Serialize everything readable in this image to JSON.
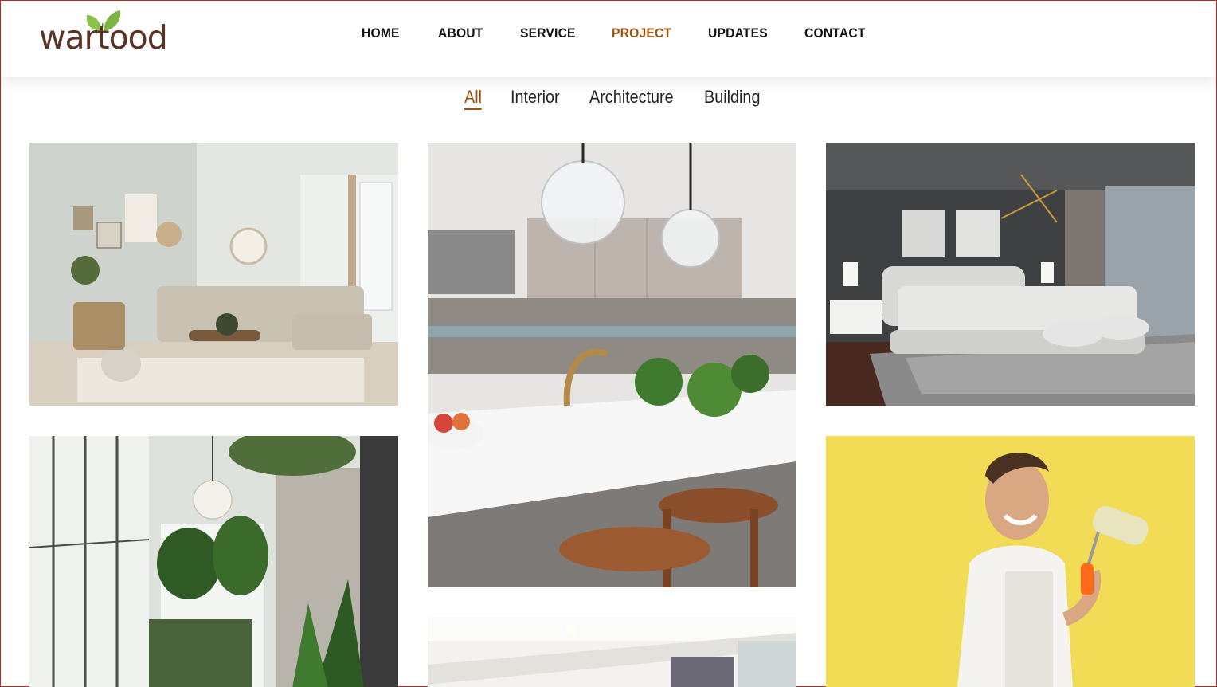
{
  "logo": {
    "text": "wartood"
  },
  "nav": {
    "items": [
      {
        "label": "HOME",
        "active": false
      },
      {
        "label": "ABOUT",
        "active": false
      },
      {
        "label": "SERVICE",
        "active": false
      },
      {
        "label": "PROJECT",
        "active": true
      },
      {
        "label": "UPDATES",
        "active": false
      },
      {
        "label": "CONTACT",
        "active": false
      }
    ]
  },
  "filters": {
    "items": [
      {
        "label": "All",
        "active": true
      },
      {
        "label": "Interior",
        "active": false
      },
      {
        "label": "Architecture",
        "active": false
      },
      {
        "label": "Building",
        "active": false
      }
    ]
  },
  "gallery": {
    "photos": [
      {
        "subject": "living-room"
      },
      {
        "subject": "kitchen"
      },
      {
        "subject": "bedroom"
      },
      {
        "subject": "sunroom"
      },
      {
        "subject": "ceiling-room"
      },
      {
        "subject": "painter"
      }
    ]
  },
  "colors": {
    "accent": "#a0520c",
    "nav_text": "#111111",
    "frame_border": "#d32020",
    "logo_brown": "#5a3324",
    "leaf_green": "#7cb342"
  }
}
